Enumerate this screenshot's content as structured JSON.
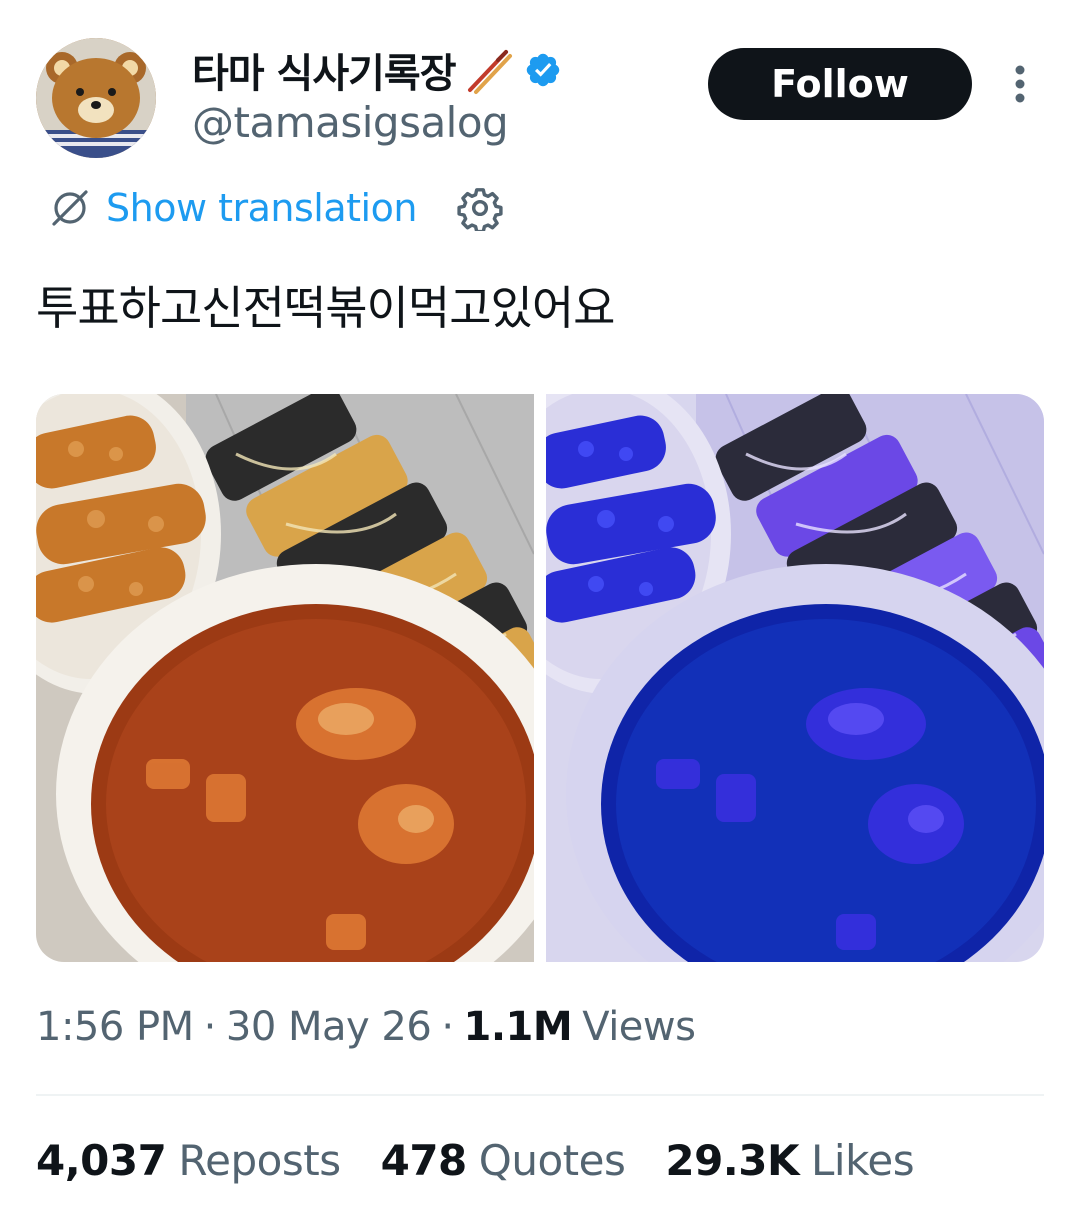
{
  "author": {
    "display_name": "타마 식사기록장",
    "handle": "@tamasigsalog",
    "verified": true
  },
  "follow_label": "Follow",
  "translation": {
    "label": "Show translation"
  },
  "tweet": {
    "text": "투표하고신전떡볶이먹고있어요"
  },
  "meta": {
    "time": "1:56 PM",
    "date": "30 May 26",
    "views_count": "1.1M",
    "views_label": "Views",
    "separator": "·"
  },
  "stats": [
    {
      "count": "4,037",
      "label": "Reposts"
    },
    {
      "count": "478",
      "label": "Quotes"
    },
    {
      "count": "29.3K",
      "label": "Likes"
    }
  ],
  "icons": {
    "avatar": "rilakkuma-bear-avatar",
    "chopsticks": "chopsticks-icon",
    "verified": "verified-badge-icon",
    "more": "more-vertical-icon",
    "translate": "globe-slash-icon",
    "settings": "gear-icon"
  },
  "colors": {
    "text": "#0f1419",
    "secondary": "#536471",
    "link": "#1d9bf0",
    "follow_bg": "#0f1419",
    "verified": "#1d9bf0"
  }
}
